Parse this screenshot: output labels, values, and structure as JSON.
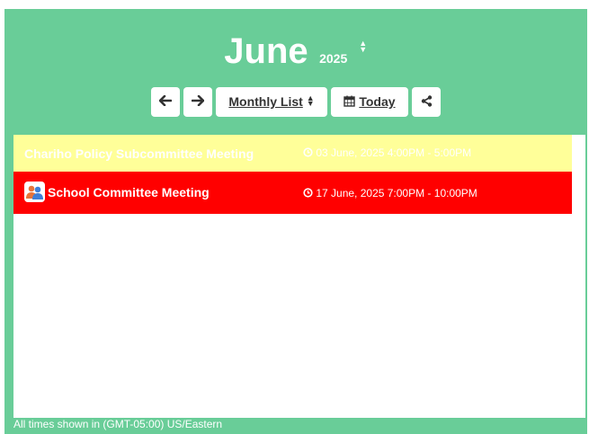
{
  "header": {
    "month": "June",
    "year": "2025"
  },
  "toolbar": {
    "prev_icon": "arrow-left-icon",
    "next_icon": "arrow-right-icon",
    "view_label": "Monthly List",
    "today_label": "Today",
    "share_icon": "share-icon"
  },
  "events": [
    {
      "name": "Chariho Policy Subcommittee Meeting",
      "time": "03 June, 2025 4:00PM - 5:00PM",
      "color": "#ffff99"
    },
    {
      "name": "School Committee Meeting",
      "time": "17 June, 2025 7:00PM - 10:00PM",
      "color": "#ff0000",
      "icon": "group-icon"
    }
  ],
  "footer": {
    "timezone_note": "All times shown in (GMT-05:00) US/Eastern"
  },
  "colors": {
    "background": "#69cd98",
    "panel": "#ffffff",
    "event_highlight": "#ffff99",
    "event_red": "#ff0000"
  }
}
